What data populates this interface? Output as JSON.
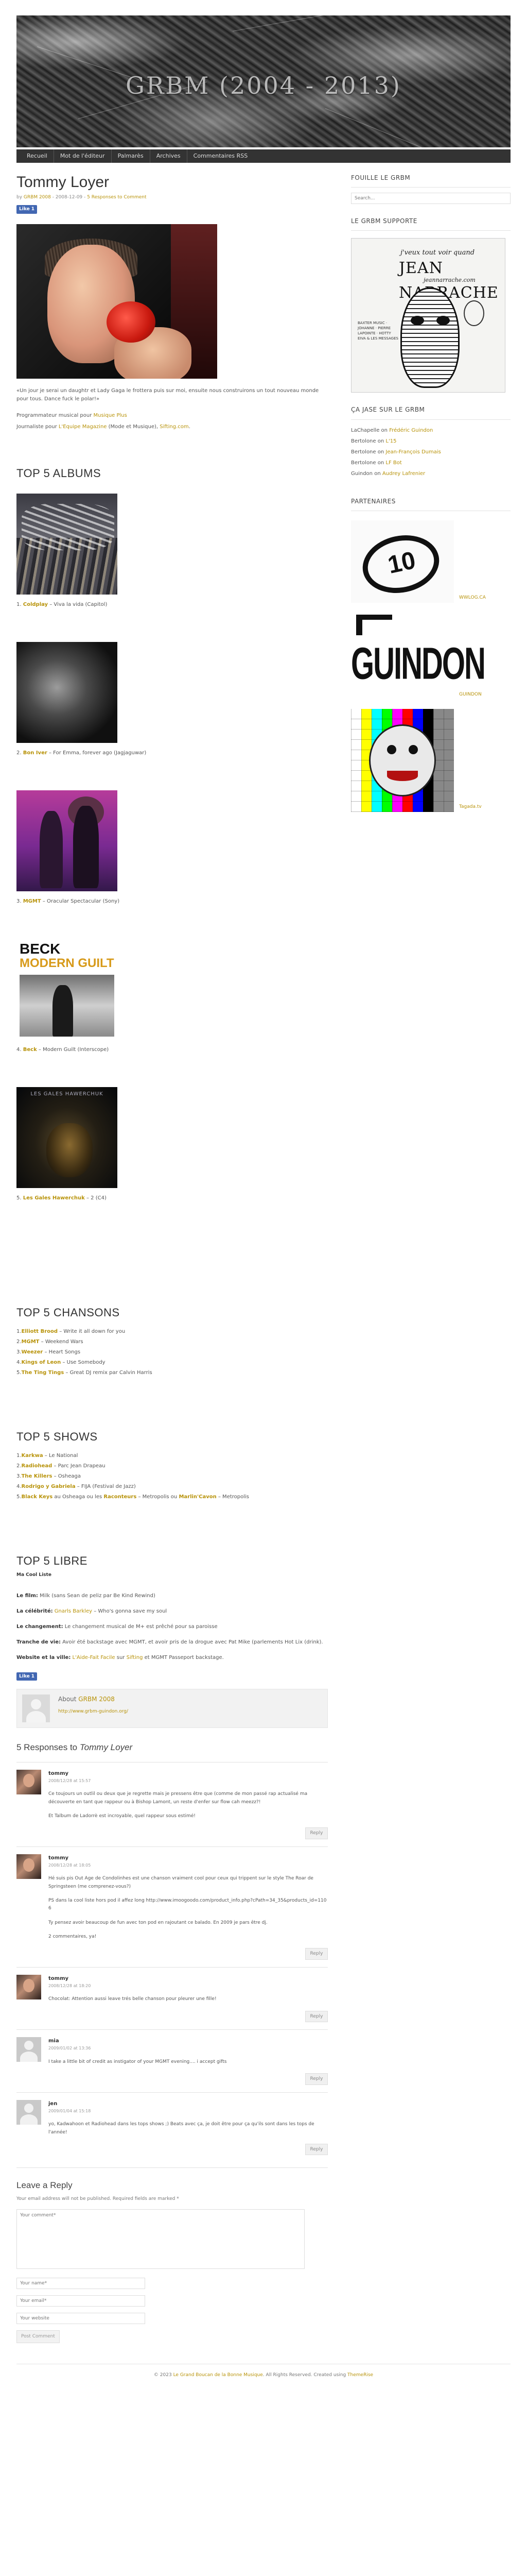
{
  "site": {
    "title": "GRBM (2004 - 2013)"
  },
  "nav": [
    "Recueil",
    "Mot de l'éditeur",
    "Palmarès",
    "Archives",
    "Commentaires RSS"
  ],
  "post": {
    "title": "Tommy Loyer",
    "meta_by": "by",
    "meta_author": "GRBM 2008",
    "meta_date": "- 2008-12-09 -",
    "meta_comments": "5 Responses to Comment",
    "like": "Like 1",
    "intro": "«Un jour je serai un daughtr et Lady Gaga le frottera puis sur moi, ensuite nous construirons un tout nouveau monde pour tous. Dance fuck le polar!»",
    "role1_prefix": "Programmateur musical pour ",
    "role1_link": "Musique Plus",
    "role2_prefix": "Journaliste pour ",
    "role2_link1": "L'Equipe Magazine",
    "role2_mid": " (Mode et Musique), ",
    "role2_link2": "Sifting.com",
    "role2_end": "."
  },
  "top_albums": {
    "heading": "TOP 5 ALBUMS",
    "items": [
      {
        "num": "1.",
        "artist": "Coldplay",
        "rest": " – Viva la vida (Capitol)"
      },
      {
        "num": "2.",
        "artist": "Bon Iver",
        "rest": " – For Emma, forever ago (Jagjaguwar)"
      },
      {
        "num": "3.",
        "artist": "MGMT",
        "rest": " – Oracular Spectacular (Sony)"
      },
      {
        "num": "4.",
        "artist": "Beck",
        "rest": " – Modern Guilt (Interscope)"
      },
      {
        "num": "5.",
        "artist": "Les Gales Hawerchuk",
        "rest": " – 2 (C4)"
      }
    ],
    "beck_cover_t1": "BECK",
    "beck_cover_t2": "MODERN GUILT",
    "lgh_cover": "LES GALES HAWERCHUK"
  },
  "top_chansons": {
    "heading": "TOP 5 CHANSONS",
    "items": [
      {
        "num": "1.",
        "artist": "Elliott Brood",
        "rest": " – Write it all down for you"
      },
      {
        "num": "2.",
        "artist": "MGMT",
        "rest": " – Weekend Wars"
      },
      {
        "num": "3.",
        "artist": "Weezer",
        "rest": " – Heart Songs"
      },
      {
        "num": "4.",
        "artist": "Kings of Leon",
        "rest": " – Use Somebody"
      },
      {
        "num": "5.",
        "artist": "The Ting Tings",
        "rest": " – Great DJ remix par Calvin Harris"
      }
    ]
  },
  "top_shows": {
    "heading": "TOP 5 SHOWS",
    "items": [
      {
        "num": "1.",
        "artist": "Karkwa",
        "prefix": "",
        "rest": " – Le National"
      },
      {
        "num": "2.",
        "artist": "Radiohead",
        "prefix": "",
        "rest": " – Parc Jean Drapeau"
      },
      {
        "num": "3.",
        "artist": "The Killers",
        "prefix": "",
        "rest": " – Osheaga"
      },
      {
        "num": "4.",
        "artist": "Rodrigo y Gabriela",
        "prefix": "",
        "rest": " – FIJA (Festival de Jazz)"
      },
      {
        "num": "5.",
        "artist": "Black Keys",
        "prefix": "",
        "rest": " au Osheaga ou les ",
        "artist2": "Raconteurs",
        "rest2": " – Metropolis ou ",
        "artist3": "Marlin'Cavon",
        "rest3": " – Metropolis"
      }
    ]
  },
  "top_libre": {
    "heading": "TOP 5 LIBRE",
    "sub": "Ma Cool Liste",
    "items": [
      {
        "label": "Le film:",
        "text": " Milk (sans Sean de peliz par Be Kind Rewind)"
      },
      {
        "label": "La célébrité:",
        "link": "Gnarls Barkley",
        "text": " – Who's gonna save my soul"
      },
      {
        "label": "Le changement:",
        "text": " Le changement musical de M+ est prêché pour sa paroisse"
      },
      {
        "label": "Tranche de vie:",
        "text": " Avoir été backstage avec MGMT, et avoir pris de la drogue avec Pat Mike (parlements Hot Lix (drink)."
      },
      {
        "label": "Website et la ville:",
        "link": "L'Aide-Fait Facile",
        "text": " sur ",
        "link2": "Sifting",
        "text2": " et MGMT Passeport backstage."
      }
    ],
    "like": "Like 1"
  },
  "author_box": {
    "about_prefix": "About ",
    "about_link": "GRBM 2008",
    "site": "http://www.grbm-guindon.org/"
  },
  "responses": {
    "count_text": "5 Responses to ",
    "post_name": "Tommy Loyer",
    "items": [
      {
        "name": "tommy",
        "date": "2008/12/28 at 15:57",
        "avatar": "photo",
        "paras": [
          "Ce toujours un outlil ou deux que je regrette mais je pressens être que (comme de mon passé rap actualisé ma découverte en tant que rappeur ou à Bishop Lamont, un reste d'enfer sur flow cah meezz?!",
          "Et Talbum de Ladorrè est incroyable, quel rappeur sous estimé!"
        ]
      },
      {
        "name": "tommy",
        "date": "2008/12/28 at 18:05",
        "avatar": "photo",
        "paras": [
          "Hé suis pis Out Age de Condolinhes est une chanson vraiment cool pour ceux qui trippent sur le style The Roar de Springsteen (me comprenez-vous?)",
          "PS dans la cool liste hors pod il affez long http://www.imoogoodo.com/product_info.php?cPath=34_35&products_id=1106",
          "Ty pensez avoir beaucoup de fun avec ton pod en rajoutant ce balado. En 2009 je pars être dj.",
          "2 commentaires, ya!"
        ]
      },
      {
        "name": "tommy",
        "date": "2008/12/28 at 18:20",
        "avatar": "photo",
        "paras": [
          "Chocolat: Attention aussi leave trés belle chanson pour pleurer une fille!"
        ]
      },
      {
        "name": "mia",
        "date": "2009/01/02 at 13:36",
        "avatar": "default",
        "paras": [
          "I take a little bit of credit as instigator of your MGMT evening.... i accept gifts"
        ]
      },
      {
        "name": "jen",
        "date": "2009/01/04 at 15:18",
        "avatar": "default",
        "paras": [
          "yo, Kadwahoon et Radiohead dans les tops shows ;) Beats avec ça, je doit être pour ça qu'ils sont dans les tops de l'année!"
        ]
      }
    ],
    "reply_label": "Reply"
  },
  "leave_reply": {
    "heading": "Leave a Reply",
    "note": "Your email address will not be published. Required fields are marked *",
    "comment_ph": "Your comment*",
    "name_ph": "Your name*",
    "email_ph": "Your email*",
    "website_ph": "Your website",
    "submit": "Post Comment"
  },
  "sidebar": {
    "search_title": "FOUILLE LE GRBM",
    "search_ph": "Search...",
    "supporte_title": "LE GRBM SUPPORTE",
    "poster_t1": "j'veux tout voir quand",
    "poster_t2": "JEAN NARRACHE",
    "poster_t3": "jeannarrache.com",
    "poster_side": "BAXTER MUSIC · JOHANNE · PIERRE LAPOINTE · HOTTY EIVA & LES MESSAGES",
    "jase_title": "ÇA JASE SUR LE GRBM",
    "jase": [
      {
        "who": "LaChapelle",
        "on": " on ",
        "what": "Frédéric Guindon"
      },
      {
        "who": "Bertolone",
        "on": " on ",
        "what": "L'15"
      },
      {
        "who": "Bertolone",
        "on": " on ",
        "what": "Jean-François Dumais"
      },
      {
        "who": "Bertolone",
        "on": " on ",
        "what": "LF Bot"
      },
      {
        "who": "Guindon",
        "on": " on ",
        "what": "Audrey Lafrenier"
      }
    ],
    "partners_title": "PARTENAIRES",
    "partners": [
      {
        "label": "WWLOG.CA"
      },
      {
        "label": "GUINDON"
      },
      {
        "label": "Tagada.tv"
      }
    ],
    "logo10_num": "10",
    "logoG_word": "GUINDON"
  },
  "footer": {
    "prefix": "© 2023 ",
    "link1": "Le Grand Boucan de la Bonne Musique",
    "mid": ". All Rights Reserved. Created using ",
    "link2": "ThemeRise"
  }
}
